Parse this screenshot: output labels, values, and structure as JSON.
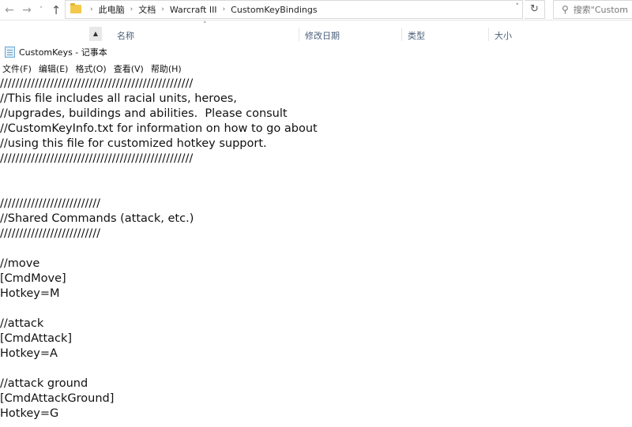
{
  "explorer": {
    "breadcrumbs": [
      "此电脑",
      "文档",
      "Warcraft III",
      "CustomKeyBindings"
    ],
    "search_placeholder": "搜索\"Custom",
    "columns": [
      "名称",
      "修改日期",
      "类型",
      "大小"
    ],
    "icons": {
      "back": "arrow-left-icon",
      "forward": "arrow-right-icon",
      "up": "arrow-up-icon",
      "refresh": "refresh-icon",
      "search": "search-icon",
      "folder": "folder-icon"
    }
  },
  "notepad": {
    "title": "CustomKeys - 记事本",
    "menu": [
      "文件(F)",
      "编辑(E)",
      "格式(O)",
      "查看(V)",
      "帮助(H)"
    ],
    "lines": [
      "//////////////////////////////////////////////////",
      "//This file includes all racial units, heroes,",
      "//upgrades, buildings and abilities.  Please consult",
      "//CustomKeyInfo.txt for information on how to go about",
      "//using this file for customized hotkey support.",
      "//////////////////////////////////////////////////",
      "",
      "",
      "//////////////////////////",
      "//Shared Commands (attack, etc.)",
      "//////////////////////////",
      "",
      "//move",
      "[CmdMove]",
      "Hotkey=M",
      "",
      "//attack",
      "[CmdAttack]",
      "Hotkey=A",
      "",
      "//attack ground",
      "[CmdAttackGround]",
      "Hotkey=G"
    ]
  }
}
